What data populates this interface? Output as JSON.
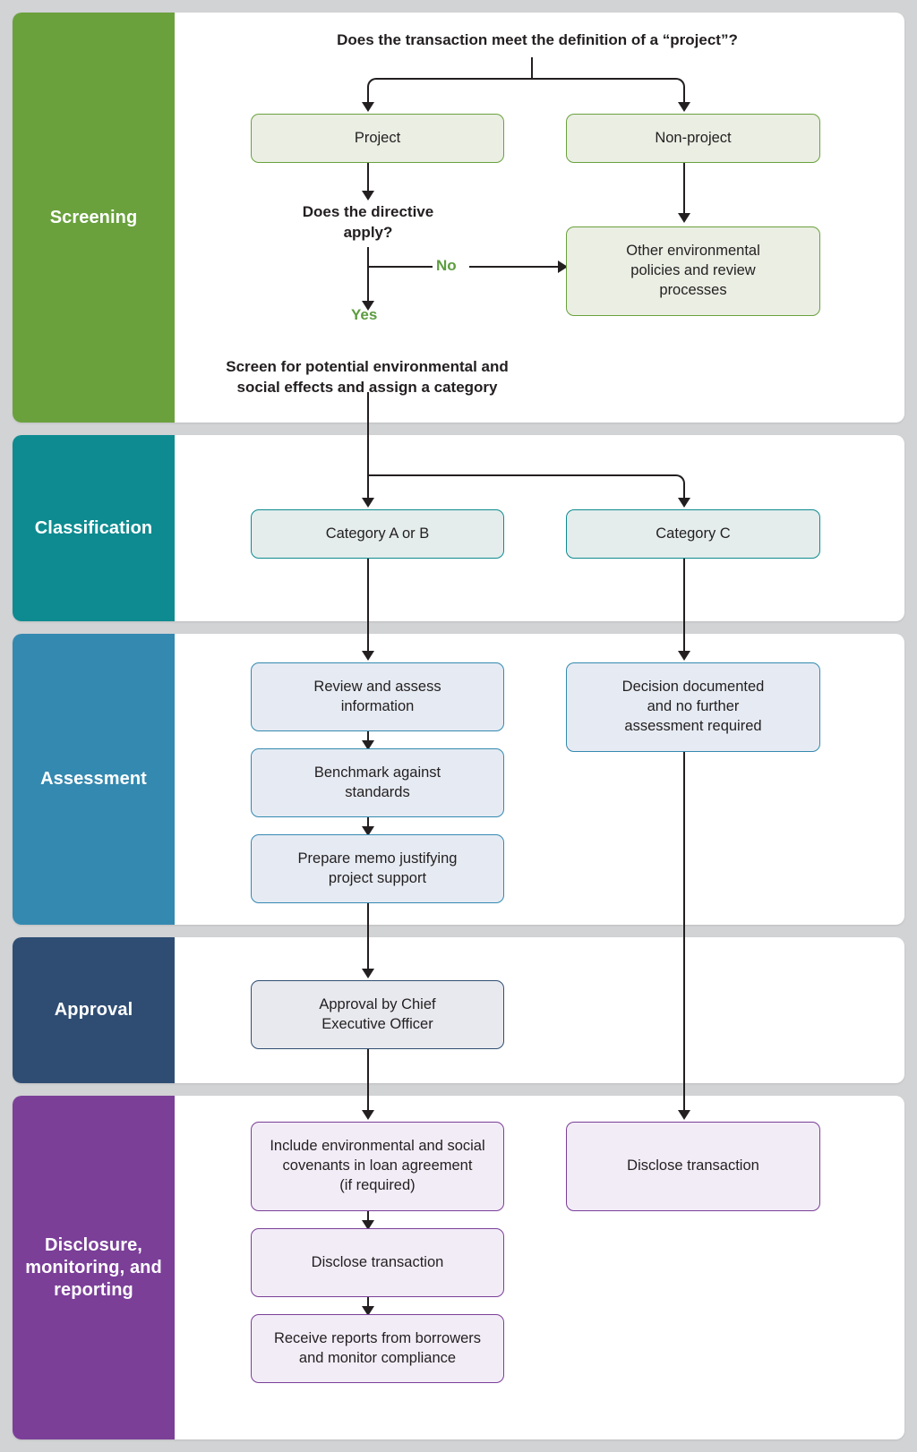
{
  "diagram": {
    "title_question": "Does the transaction meet the definition of a “project”?",
    "colors": {
      "canvas": "#d2d3d5",
      "panel": "#ffffff",
      "screening": "#6aa13d",
      "classification": "#0d8b90",
      "assessment": "#3489b0",
      "approval": "#2f4d73",
      "disclosure": "#7b3f98",
      "yes_no_label": "#5d9c3f",
      "connector": "#231f20",
      "screening_box_fill": "#eaeee3",
      "screening_box_border": "#6aa13d",
      "classification_box_fill": "#e4edec",
      "classification_box_border": "#0d8b90",
      "assessment_box_fill": "#e6ebf3",
      "assessment_box_border": "#3489b0",
      "approval_box_fill": "#e8e9ee",
      "approval_box_border": "#2f4d73",
      "disclosure_box_fill": "#f2ecf7",
      "disclosure_box_border": "#7b3f98"
    }
  },
  "stages": [
    {
      "key": "screening",
      "label": "Screening",
      "nodes": [
        {
          "id": "project",
          "text": "Project"
        },
        {
          "id": "non-project",
          "text": "Non-project"
        },
        {
          "id": "other-policies",
          "text": "Other environmental\npolicies and review\nprocesses"
        }
      ],
      "texts": [
        {
          "id": "directive-question",
          "text": "Does the directive\napply?"
        },
        {
          "id": "screen-category",
          "text": "Screen for potential environmental and\nsocial effects and assign a category"
        }
      ],
      "flags": [
        {
          "id": "flag-no",
          "text": "No"
        },
        {
          "id": "flag-yes",
          "text": "Yes"
        }
      ]
    },
    {
      "key": "classification",
      "label": "Classification",
      "nodes": [
        {
          "id": "category-ab",
          "text": "Category A or B"
        },
        {
          "id": "category-c",
          "text": "Category C"
        }
      ],
      "texts": [],
      "flags": []
    },
    {
      "key": "assessment",
      "label": "Assessment",
      "nodes": [
        {
          "id": "review-assess",
          "text": "Review and assess\ninformation"
        },
        {
          "id": "benchmark",
          "text": "Benchmark against\nstandards"
        },
        {
          "id": "prepare-memo",
          "text": "Prepare memo justifying\nproject support"
        },
        {
          "id": "decision-documented",
          "text": "Decision documented\nand no further\nassessment required"
        }
      ],
      "texts": [],
      "flags": []
    },
    {
      "key": "approval",
      "label": "Approval",
      "nodes": [
        {
          "id": "approval-ceo",
          "text": "Approval by Chief\nExecutive Officer"
        }
      ],
      "texts": [],
      "flags": []
    },
    {
      "key": "disclosure",
      "label": "Disclosure,\nmonitoring,\nand reporting",
      "nodes": [
        {
          "id": "covenants",
          "text": "Include environmental and social\ncovenants in loan agreement\n(if required)"
        },
        {
          "id": "disclose-left",
          "text": "Disclose transaction"
        },
        {
          "id": "receive-reports",
          "text": "Receive reports from borrowers\nand monitor compliance"
        },
        {
          "id": "disclose-right",
          "text": "Disclose transaction"
        }
      ],
      "texts": [],
      "flags": []
    }
  ]
}
